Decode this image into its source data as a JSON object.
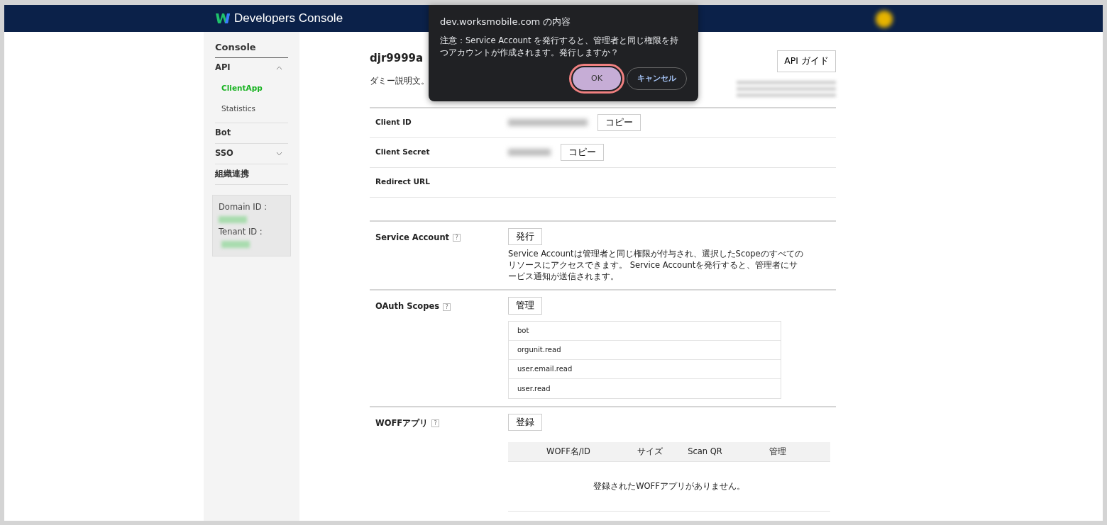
{
  "header": {
    "title": "Developers Console"
  },
  "sidebar": {
    "title": "Console",
    "items": [
      {
        "label": "API",
        "expanded": true,
        "children": [
          {
            "label": "ClientApp",
            "selected": true
          },
          {
            "label": "Statistics",
            "selected": false
          }
        ]
      },
      {
        "label": "Bot"
      },
      {
        "label": "SSO",
        "expanded": false
      },
      {
        "label": "組織連携"
      }
    ],
    "info": [
      {
        "label": "Domain ID :",
        "value_hidden": true
      },
      {
        "label": "Tenant ID :",
        "value_hidden": true
      }
    ]
  },
  "app": {
    "name": "djr9999a",
    "description": "ダミー説明文。",
    "guide_button": "API ガイド",
    "meta_hidden": true
  },
  "credentials": [
    {
      "label": "Client ID",
      "value_hidden": true,
      "button": "コピー"
    },
    {
      "label": "Client Secret",
      "value_hidden": true,
      "button": "コピー"
    },
    {
      "label": "Redirect URL",
      "value_hidden": false
    }
  ],
  "service_account": {
    "label": "Service Account",
    "help": "?",
    "button": "発行",
    "note": "Service Accountは管理者と同じ権限が付与され、選択したScopeのすべてのリソースにアクセスできます。 Service Accountを発行すると、管理者にサービス通知が送信されます。"
  },
  "oauth_scopes": {
    "label": "OAuth Scopes",
    "help": "?",
    "button": "管理",
    "scopes": [
      "bot",
      "orgunit.read",
      "user.email.read",
      "user.read"
    ]
  },
  "woff": {
    "label": "WOFFアプリ",
    "help": "?",
    "button": "登録",
    "columns": [
      "WOFF名/ID",
      "サイズ",
      "Scan QR",
      "管理"
    ],
    "empty_message": "登録されたWOFFアプリがありません。"
  },
  "dialog": {
    "title": "dev.worksmobile.com の内容",
    "message": "注意：Service Account を発行すると、管理者と同じ権限を持つアカウントが作成されます。発行しますか？",
    "buttons": [
      {
        "label": "OK",
        "kind": "primary",
        "focused": true
      },
      {
        "label": "キャンセル",
        "kind": "secondary",
        "focused": false
      }
    ]
  }
}
